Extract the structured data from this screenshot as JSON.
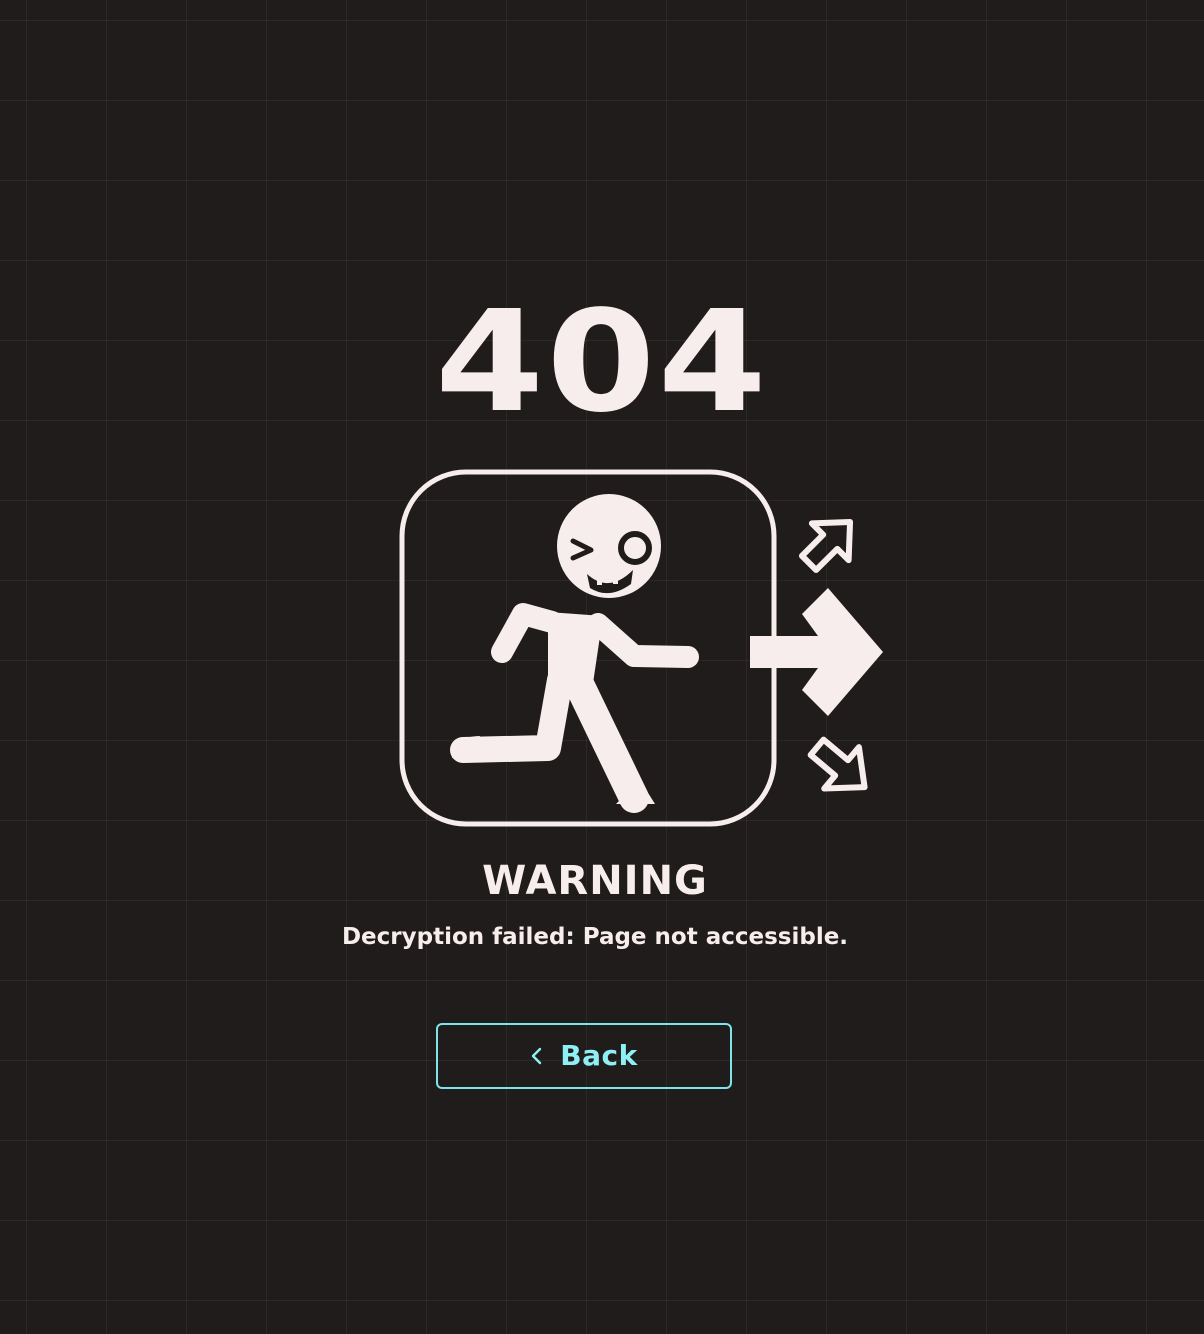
{
  "error": {
    "code": "404",
    "title": "WARNING",
    "message": "Decryption failed: Page not accessible."
  },
  "actions": {
    "back_label": "Back",
    "back_icon": "chevron-left-icon"
  },
  "illustration": {
    "icon": "emergency-exit-running-man-icon"
  },
  "colors": {
    "background": "#201c1c",
    "grid_line": "#2e2a2a",
    "foreground": "#f7eded",
    "accent": "#7fe3ea"
  }
}
